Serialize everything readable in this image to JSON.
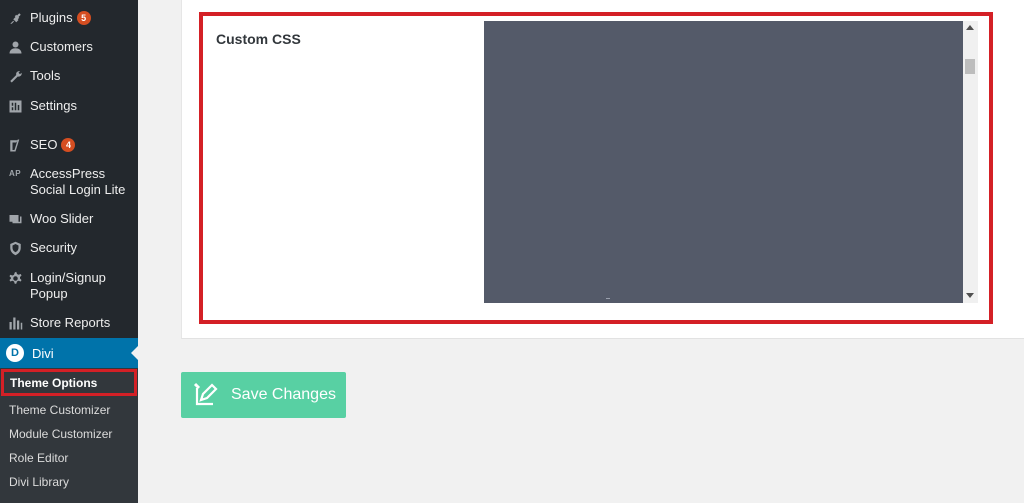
{
  "sidebar": {
    "items": [
      {
        "label": "Plugins",
        "badge": "5",
        "icon": "plugins-icon"
      },
      {
        "label": "Customers",
        "icon": "user-icon"
      },
      {
        "label": "Tools",
        "icon": "wrench-icon"
      },
      {
        "label": "Settings",
        "icon": "settings-icon"
      },
      {
        "label": "SEO",
        "badge": "4",
        "icon": "yoast-icon"
      },
      {
        "label": "AccessPress Social Login Lite",
        "icon": "ap-icon",
        "icon_text": "AP"
      },
      {
        "label": "Woo Slider",
        "icon": "slides-icon"
      },
      {
        "label": "Security",
        "icon": "shield-icon"
      },
      {
        "label": "Login/Signup Popup",
        "icon": "gear-icon"
      },
      {
        "label": "Store Reports",
        "icon": "bar-chart-icon"
      }
    ],
    "active": {
      "label": "Divi",
      "logo_letter": "D",
      "icon": "divi-logo-icon"
    },
    "submenu": [
      {
        "label": "Theme Options",
        "current": true
      },
      {
        "label": "Theme Customizer"
      },
      {
        "label": "Module Customizer"
      },
      {
        "label": "Role Editor"
      },
      {
        "label": "Divi Library"
      }
    ]
  },
  "main": {
    "custom_css": {
      "label": "Custom CSS",
      "value": ""
    },
    "save_button": {
      "label": "Save Changes",
      "icon": "edit-icon"
    }
  },
  "colors": {
    "sidebar_bg": "#23282d",
    "active_bg": "#0073aa",
    "highlight": "#d42026",
    "save_button_bg": "#58d0a3",
    "editor_bg": "#545a69",
    "badge_bg": "#d54e21"
  }
}
